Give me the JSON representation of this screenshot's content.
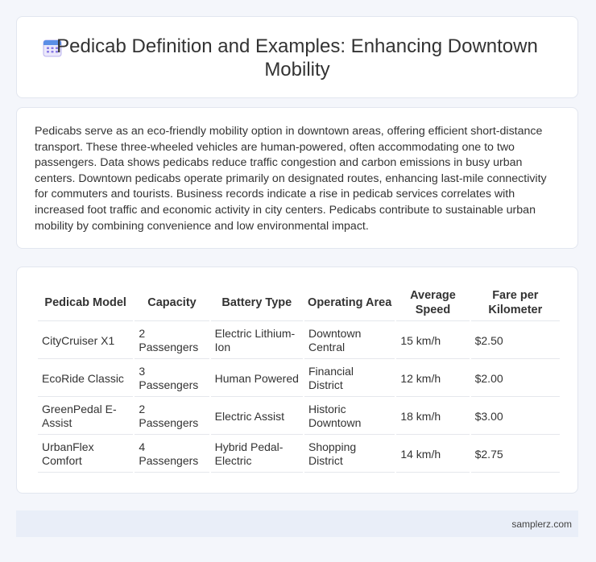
{
  "header": {
    "icon": "calendar-icon",
    "title": "Pedicab Definition and Examples: Enhancing Downtown Mobility"
  },
  "description": "Pedicabs serve as an eco-friendly mobility option in downtown areas, offering efficient short-distance transport. These three-wheeled vehicles are human-powered, often accommodating one to two passengers. Data shows pedicabs reduce traffic congestion and carbon emissions in busy urban centers. Downtown pedicabs operate primarily on designated routes, enhancing last-mile connectivity for commuters and tourists. Business records indicate a rise in pedicab services correlates with increased foot traffic and economic activity in city centers. Pedicabs contribute to sustainable urban mobility by combining convenience and low environmental impact.",
  "table": {
    "headers": [
      "Pedicab Model",
      "Capacity",
      "Battery Type",
      "Operating Area",
      "Average Speed",
      "Fare per Kilometer"
    ],
    "rows": [
      [
        "CityCruiser X1",
        "2 Passengers",
        "Electric Lithium-Ion",
        "Downtown Central",
        "15 km/h",
        "$2.50"
      ],
      [
        "EcoRide Classic",
        "3 Passengers",
        "Human Powered",
        "Financial District",
        "12 km/h",
        "$2.00"
      ],
      [
        "GreenPedal E-Assist",
        "2 Passengers",
        "Electric Assist",
        "Historic Downtown",
        "18 km/h",
        "$3.00"
      ],
      [
        "UrbanFlex Comfort",
        "4 Passengers",
        "Hybrid Pedal-Electric",
        "Shopping District",
        "14 km/h",
        "$2.75"
      ]
    ]
  },
  "footer": {
    "site": "samplerz.com"
  },
  "colors": {
    "icon_accent": "#8a7be6",
    "icon_header": "#5b8fe6",
    "footer_bg": "#e9eef8"
  }
}
